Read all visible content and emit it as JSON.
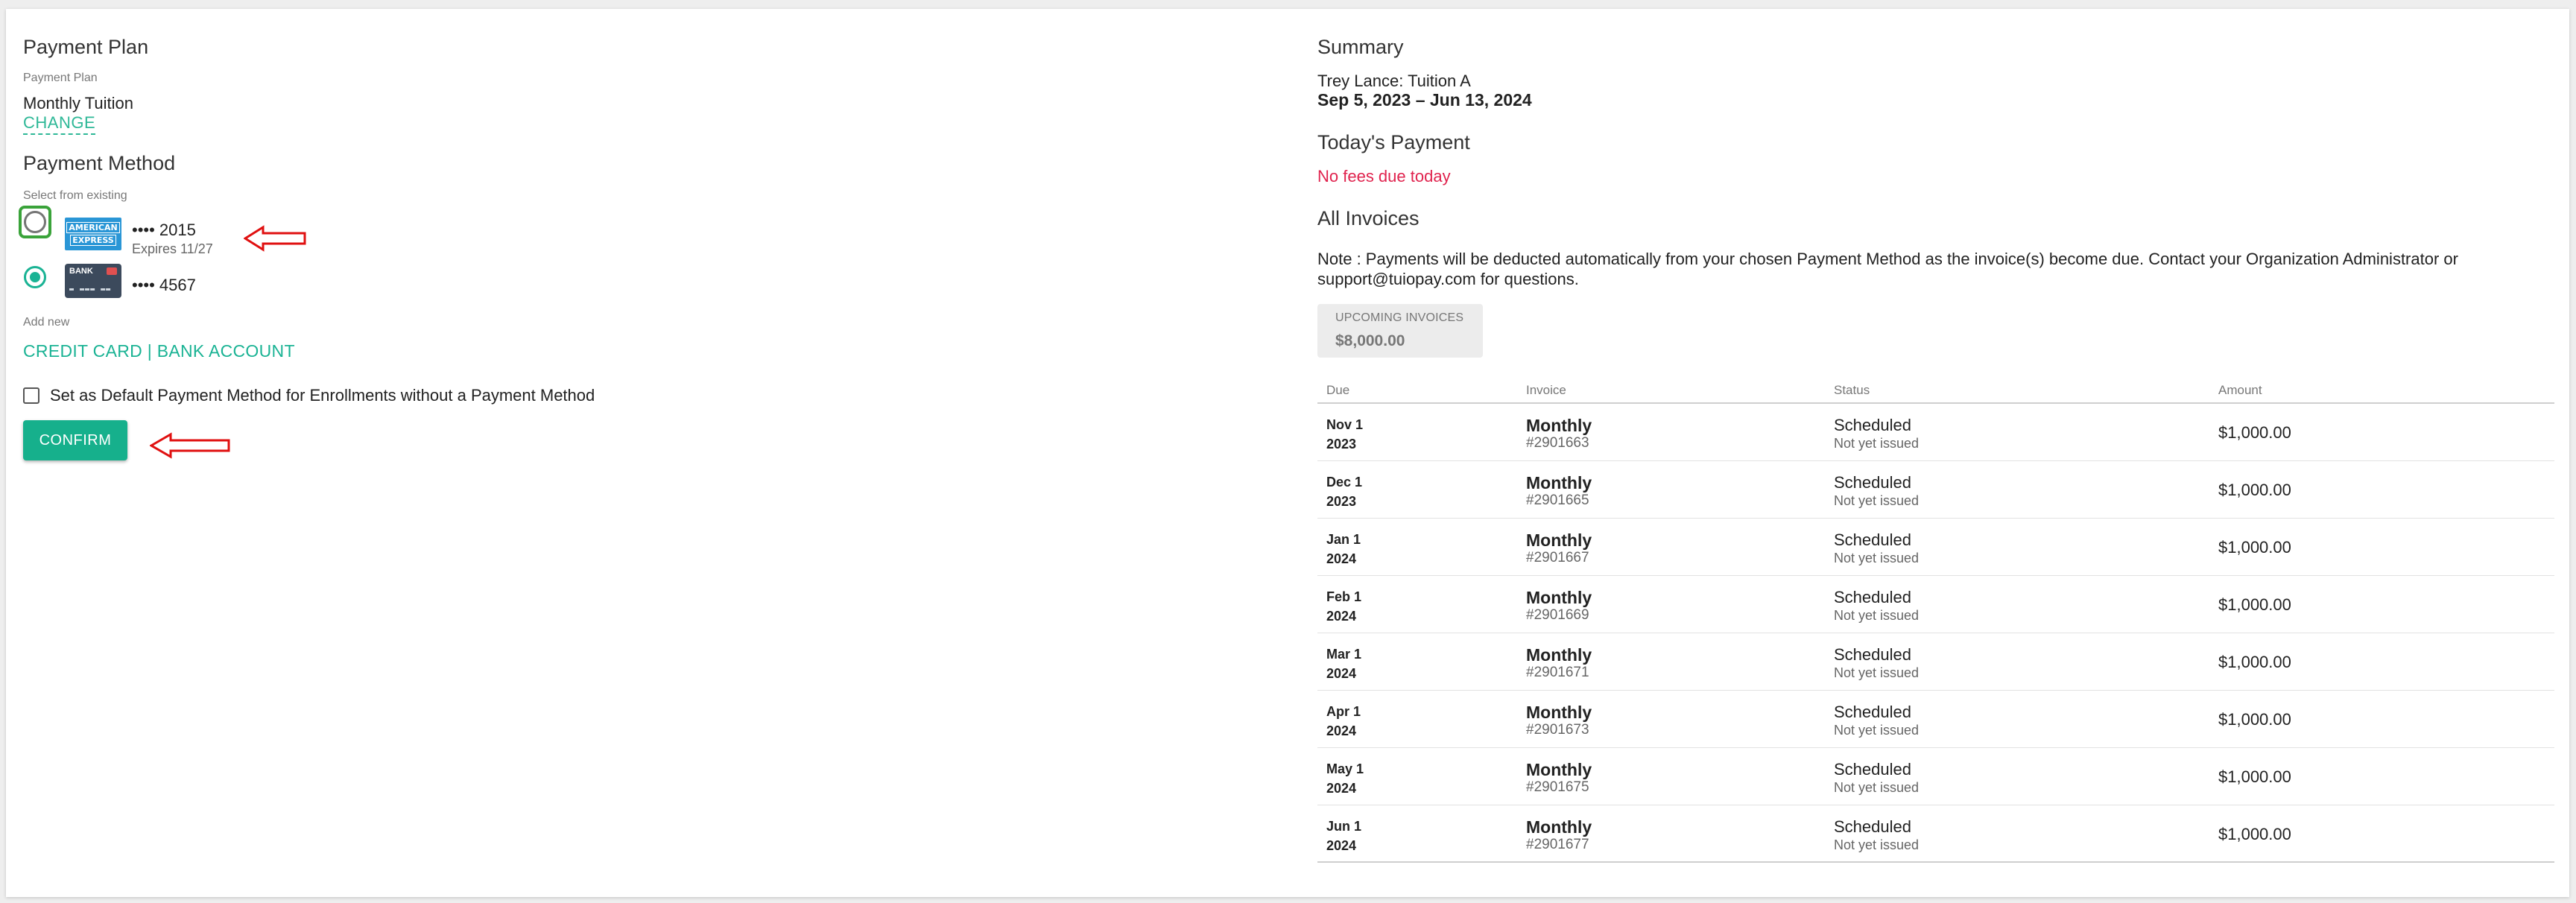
{
  "payment_plan": {
    "title": "Payment Plan",
    "label": "Payment Plan",
    "value": "Monthly Tuition",
    "change_label": "CHANGE"
  },
  "payment_method": {
    "title": "Payment Method",
    "existing_label": "Select from existing",
    "methods": [
      {
        "type": "amex",
        "logo_text_1": "AMERICAN",
        "logo_text_2": "EXPRESS",
        "number": "•••• 2015",
        "expires": "Expires 11/27",
        "selected": false
      },
      {
        "type": "bank",
        "logo_text": "BANK",
        "logo_digits": "▬ ▬▬▬ ▬▬",
        "number": "•••• 4567",
        "selected": true
      }
    ],
    "add_new_label": "Add new",
    "add_credit_card": "CREDIT CARD",
    "add_separator": " | ",
    "add_bank_account": "BANK ACCOUNT",
    "default_checkbox_label": "Set as Default Payment Method for Enrollments without a Payment Method",
    "confirm_label": "CONFIRM"
  },
  "summary": {
    "title": "Summary",
    "student_line": "Trey Lance: Tuition A",
    "date_range": "Sep 5, 2023 – Jun 13, 2024",
    "today_title": "Today's Payment",
    "today_fees": "No fees due today",
    "invoices_title": "All Invoices",
    "note": "Note : Payments will be deducted automatically from your chosen Payment Method as the invoice(s) become due. Contact your Organization Administrator or support@tuiopay.com for questions.",
    "upcoming_label": "UPCOMING INVOICES",
    "upcoming_amount": "$8,000.00"
  },
  "invoice_table": {
    "headers": {
      "due": "Due",
      "invoice": "Invoice",
      "status": "Status",
      "amount": "Amount"
    },
    "rows": [
      {
        "due_md": "Nov 1",
        "due_yr": "2023",
        "name": "Monthly",
        "number": "#2901663",
        "status": "Scheduled",
        "status_sub": "Not yet issued",
        "amount": "$1,000.00"
      },
      {
        "due_md": "Dec 1",
        "due_yr": "2023",
        "name": "Monthly",
        "number": "#2901665",
        "status": "Scheduled",
        "status_sub": "Not yet issued",
        "amount": "$1,000.00"
      },
      {
        "due_md": "Jan 1",
        "due_yr": "2024",
        "name": "Monthly",
        "number": "#2901667",
        "status": "Scheduled",
        "status_sub": "Not yet issued",
        "amount": "$1,000.00"
      },
      {
        "due_md": "Feb 1",
        "due_yr": "2024",
        "name": "Monthly",
        "number": "#2901669",
        "status": "Scheduled",
        "status_sub": "Not yet issued",
        "amount": "$1,000.00"
      },
      {
        "due_md": "Mar 1",
        "due_yr": "2024",
        "name": "Monthly",
        "number": "#2901671",
        "status": "Scheduled",
        "status_sub": "Not yet issued",
        "amount": "$1,000.00"
      },
      {
        "due_md": "Apr 1",
        "due_yr": "2024",
        "name": "Monthly",
        "number": "#2901673",
        "status": "Scheduled",
        "status_sub": "Not yet issued",
        "amount": "$1,000.00"
      },
      {
        "due_md": "May 1",
        "due_yr": "2024",
        "name": "Monthly",
        "number": "#2901675",
        "status": "Scheduled",
        "status_sub": "Not yet issued",
        "amount": "$1,000.00"
      },
      {
        "due_md": "Jun 1",
        "due_yr": "2024",
        "name": "Monthly",
        "number": "#2901677",
        "status": "Scheduled",
        "status_sub": "Not yet issued",
        "amount": "$1,000.00"
      }
    ]
  },
  "colors": {
    "accent": "#1ab394",
    "danger": "#e0234e",
    "annotation_arrow": "#e01010",
    "highlight_box": "#3aa33a"
  },
  "icons": {
    "annotation": "left-arrow-icon",
    "amex": "amex-card-icon",
    "bank": "bank-card-icon"
  }
}
